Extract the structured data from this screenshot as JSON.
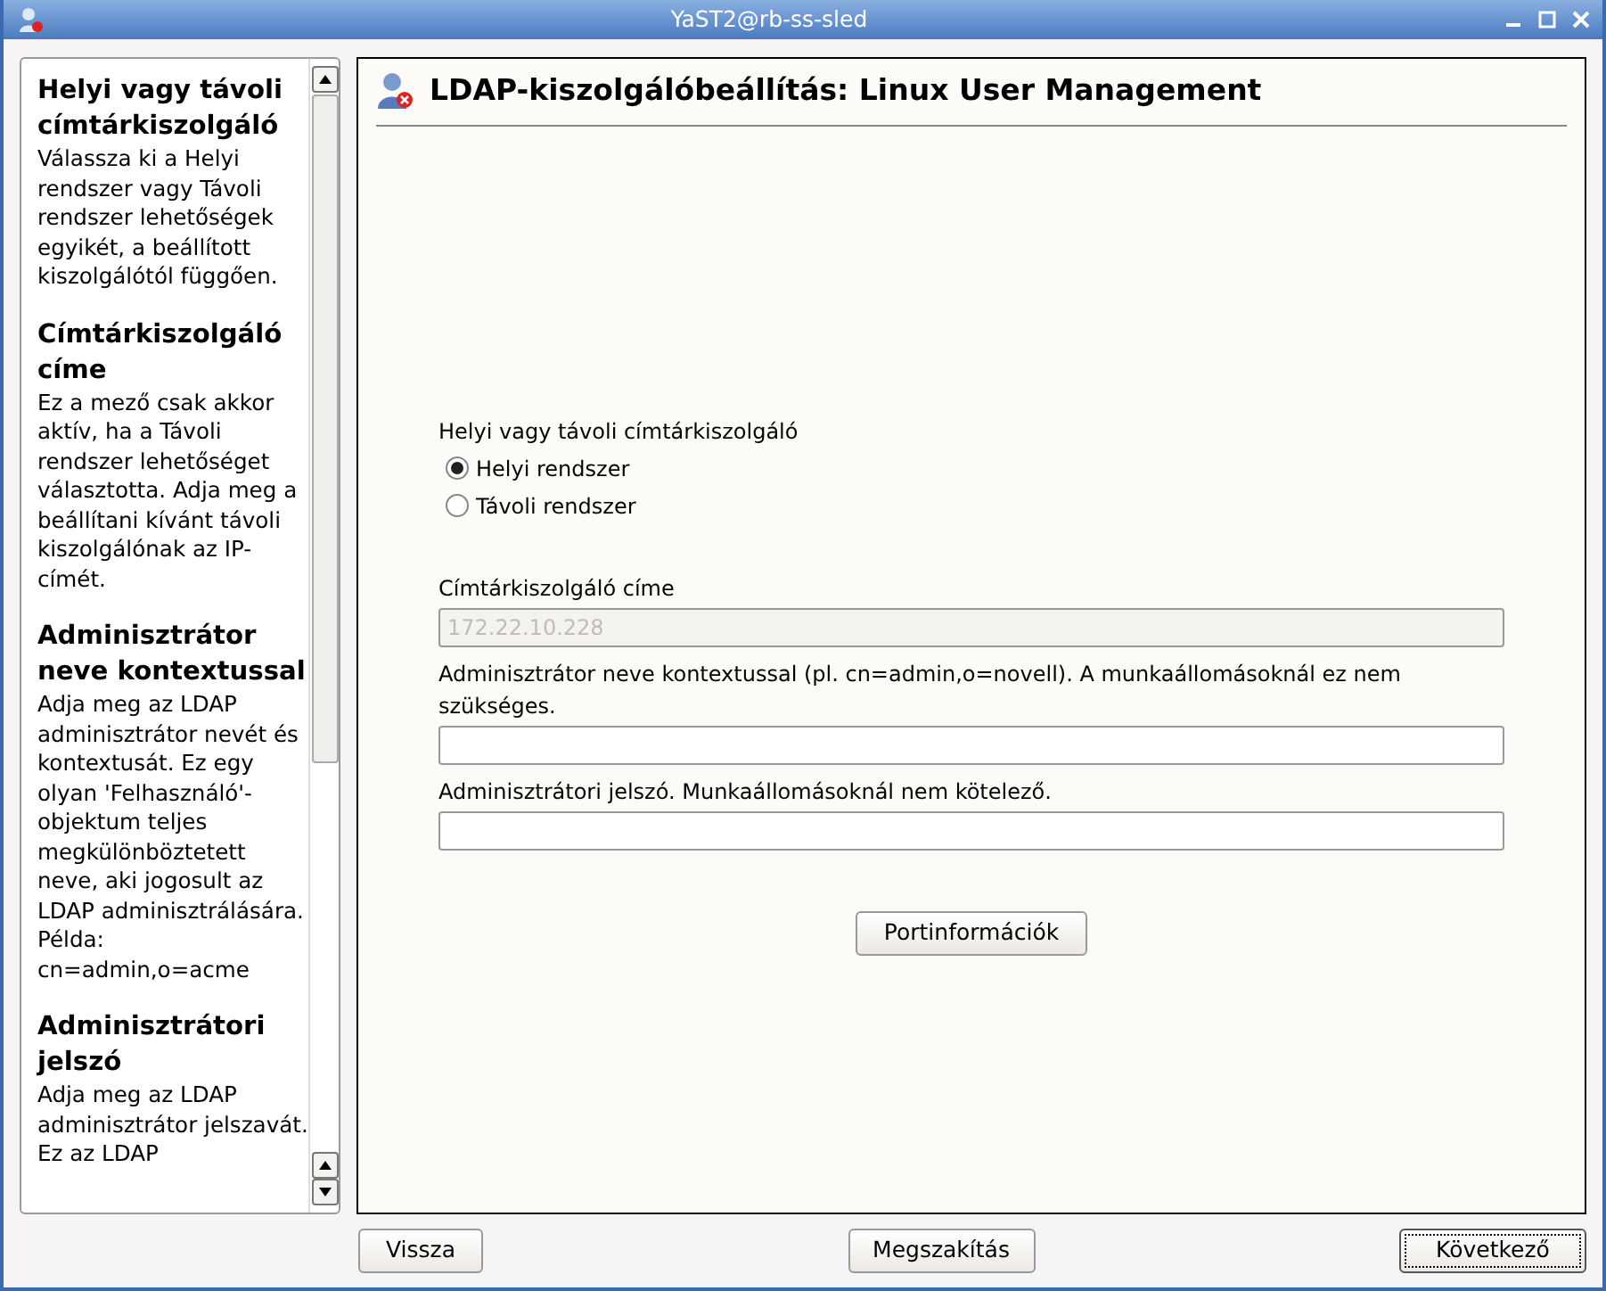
{
  "window": {
    "title": "YaST2@rb-ss-sled"
  },
  "help": [
    {
      "heading": "Helyi vagy távoli címtárkiszolgáló",
      "text": "Válassza ki a Helyi rendszer vagy Távoli rendszer lehetőségek egyikét, a beállított kiszolgálótól függően."
    },
    {
      "heading": "Címtárkiszolgáló címe",
      "text": "Ez a mező csak akkor aktív, ha a Távoli rendszer lehetőséget választotta. Adja meg a beállítani kívánt távoli kiszolgálónak az IP-címét."
    },
    {
      "heading": "Adminisztrátor neve kontextussal",
      "text": "Adja meg az LDAP adminisztrátor nevét és kontextusát. Ez egy olyan 'Felhasználó'-objektum teljes megkülönböztetett neve, aki jogosult az LDAP adminisztrálására. Példa: cn=admin,o=acme"
    },
    {
      "heading": "Adminisztrátori jelszó",
      "text": "Adja meg az LDAP adminisztrátor jelszavát. Ez az LDAP"
    }
  ],
  "dialog_title": "LDAP-kiszolgálóbeállítás: Linux User Management",
  "server_type": {
    "label": "Helyi vagy távoli címtárkiszolgáló",
    "options": [
      {
        "label": "Helyi rendszer",
        "selected": true
      },
      {
        "label": "Távoli rendszer",
        "selected": false
      }
    ]
  },
  "fields": [
    {
      "label": "Címtárkiszolgáló címe",
      "placeholder": "172.22.10.228",
      "disabled": true
    },
    {
      "label": "Adminisztrátor neve kontextussal (pl. cn=admin,o=novell). A munkaállomásoknál ez nem szükséges.",
      "disabled": false
    },
    {
      "label": "Adminisztrátori jelszó. Munkaállomásoknál nem kötelező.",
      "disabled": false
    }
  ],
  "port_button": "Portinformációk",
  "buttons": [
    {
      "label": "Vissza",
      "focused": false
    },
    {
      "label": "Megszakítás",
      "focused": false
    },
    {
      "label": "Következő",
      "focused": true
    }
  ]
}
